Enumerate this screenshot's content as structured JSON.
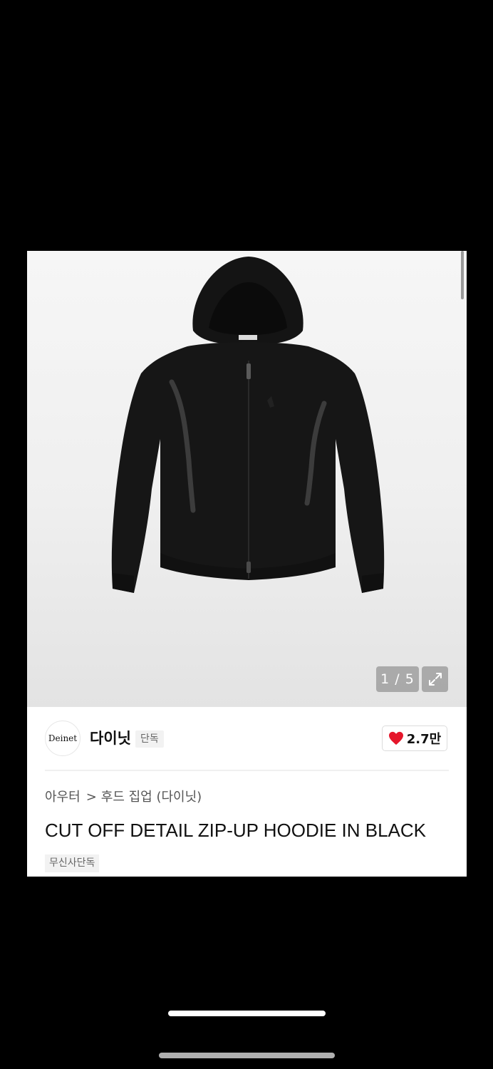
{
  "gallery": {
    "counter": "1 / 5",
    "image_alt": "hoodie-product-photo"
  },
  "brand": {
    "logo_text": "Deinet",
    "name": "다이닛",
    "badge": "단독"
  },
  "like": {
    "icon": "heart-icon",
    "count": "2.7만",
    "color": "#e5162b"
  },
  "breadcrumb": {
    "category": "아우터",
    "separator": ">",
    "subcategory": "후드 집업 (다이닛)"
  },
  "product": {
    "title": "CUT OFF DETAIL ZIP-UP HOODIE IN BLACK",
    "tag": "무신사단독"
  }
}
